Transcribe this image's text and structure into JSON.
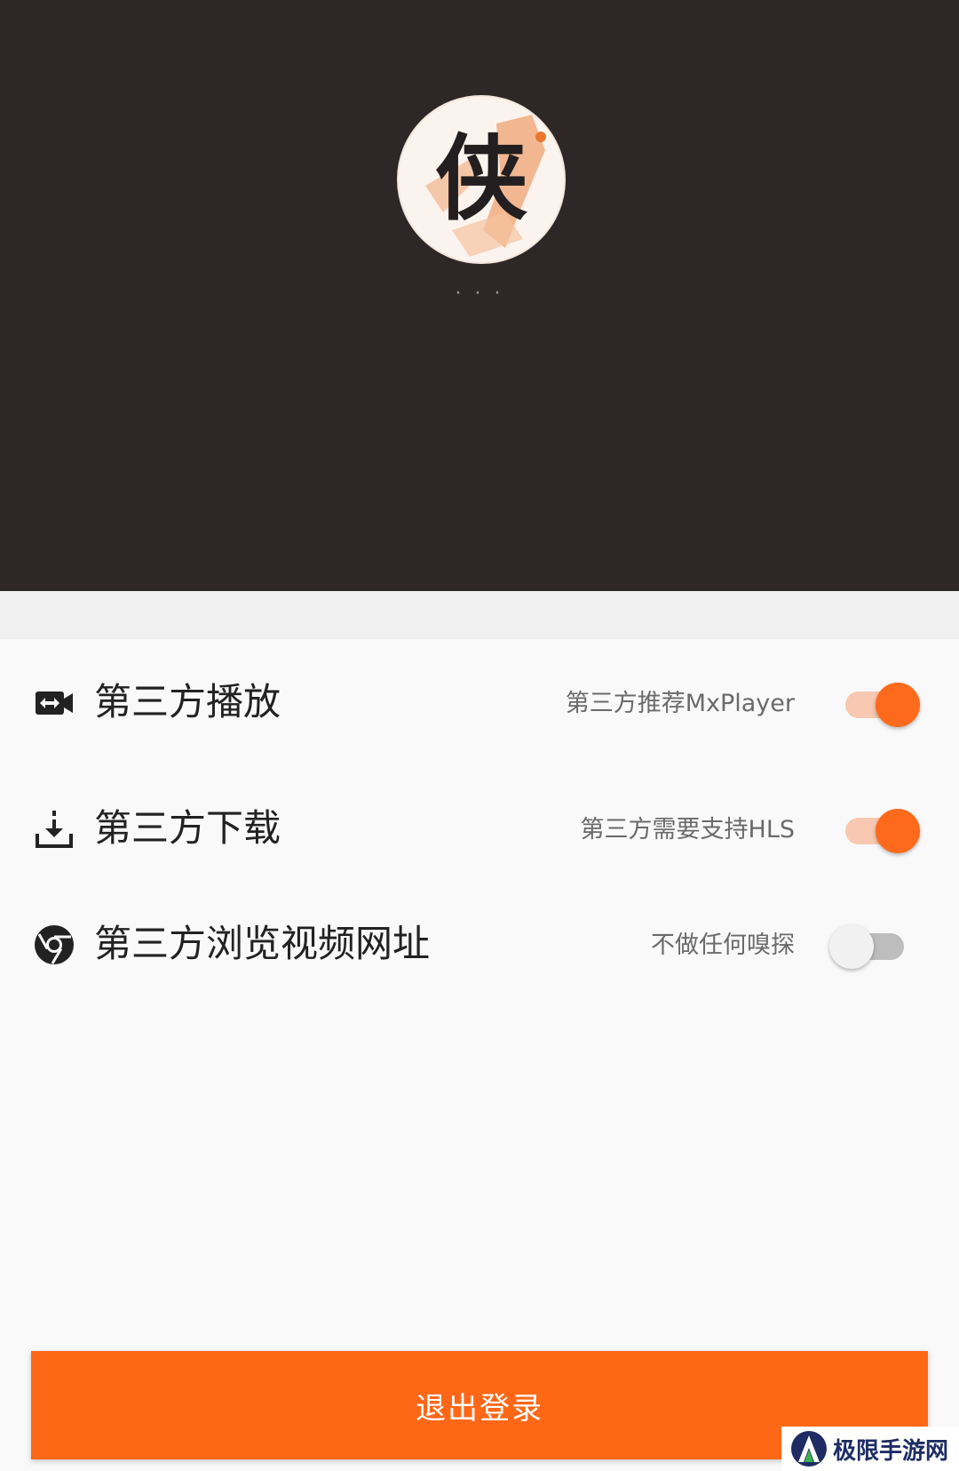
{
  "profile": {
    "avatar_glyph": "侠",
    "username": "· · ·"
  },
  "settings": [
    {
      "icon": "video-switch-icon",
      "label": "第三方播放",
      "hint": "第三方推荐MxPlayer",
      "enabled": true
    },
    {
      "icon": "download-icon",
      "label": "第三方下载",
      "hint": "第三方需要支持HLS",
      "enabled": true
    },
    {
      "icon": "chrome-icon",
      "label": "第三方浏览视频网址",
      "hint": "不做任何嗅探",
      "enabled": false
    }
  ],
  "logout_label": "退出登录",
  "watermark": {
    "text": "极限手游网"
  },
  "colors": {
    "header_bg": "#2e2728",
    "accent": "#fe6716",
    "switch_on_thumb": "#fe6a1b",
    "switch_on_track": "#f8c8b0",
    "switch_off_track": "#bdbdbd"
  }
}
